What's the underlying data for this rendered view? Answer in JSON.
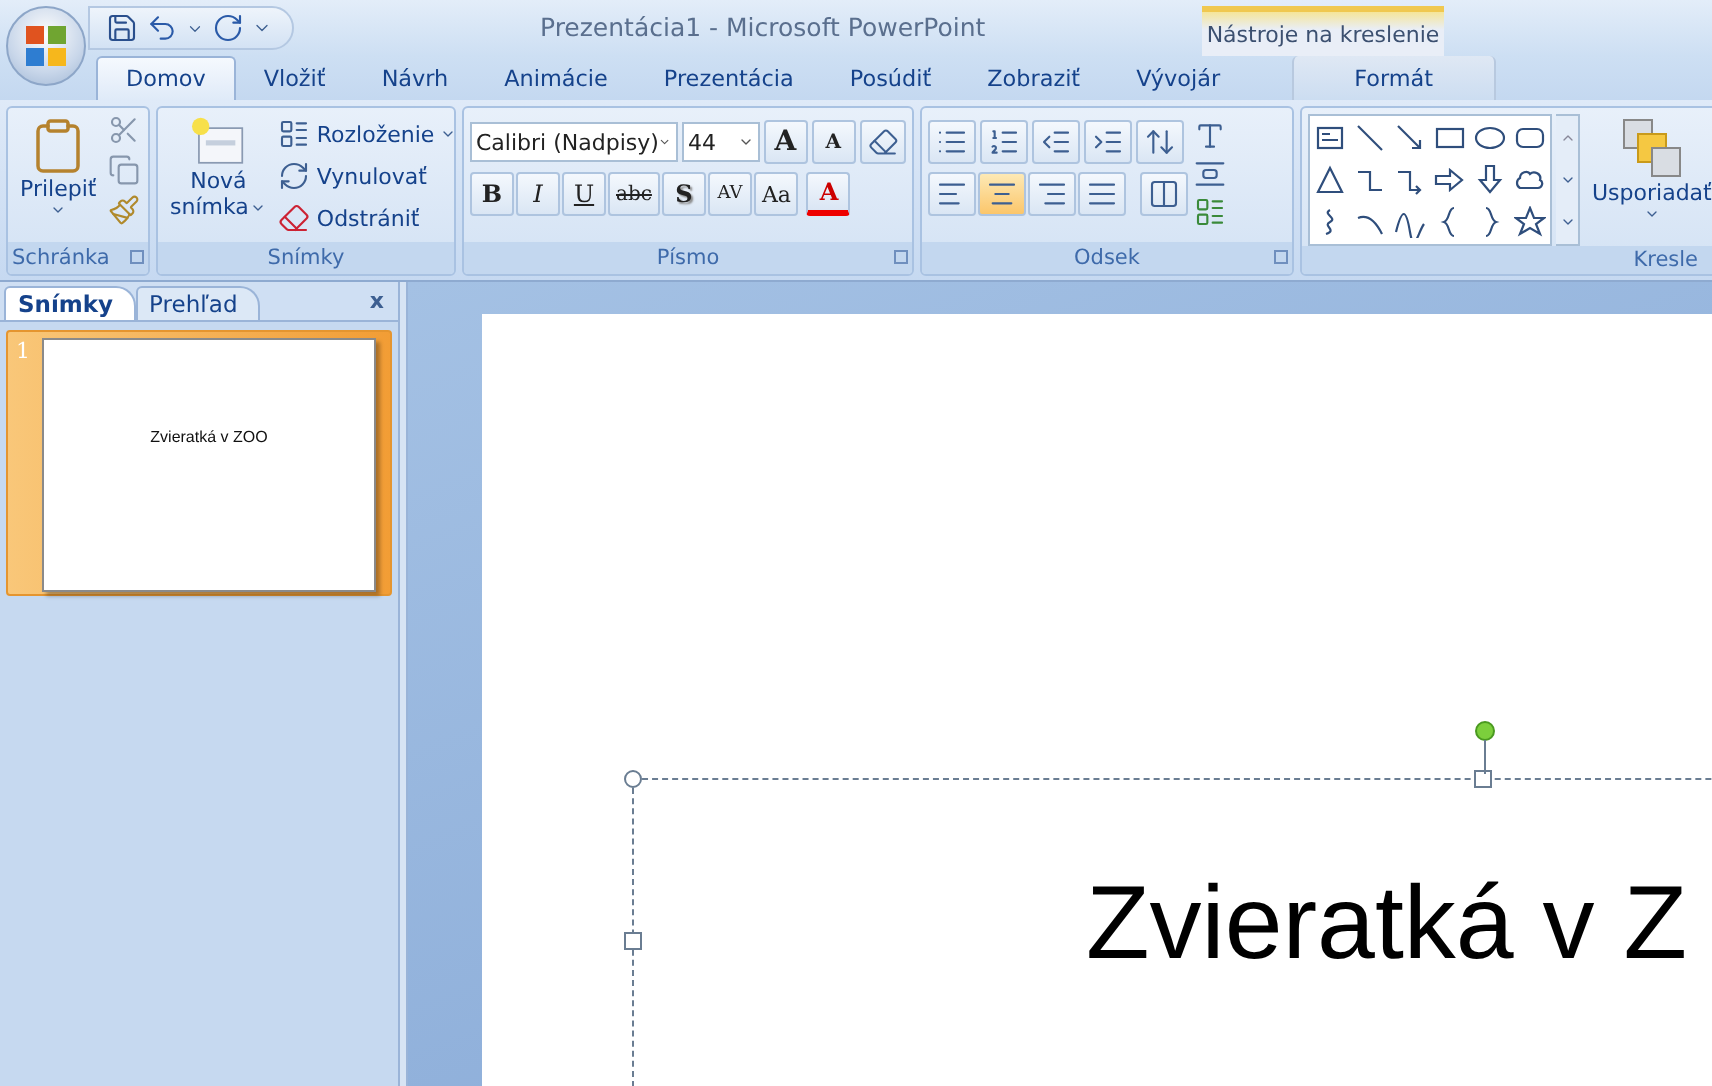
{
  "window": {
    "title": "Prezentácia1 - Microsoft PowerPoint"
  },
  "contextual_group": {
    "label": "Nástroje na kreslenie"
  },
  "tabs": [
    {
      "label": "Domov",
      "selected": true,
      "contextual": false
    },
    {
      "label": "Vložiť",
      "selected": false,
      "contextual": false
    },
    {
      "label": "Návrh",
      "selected": false,
      "contextual": false
    },
    {
      "label": "Animácie",
      "selected": false,
      "contextual": false
    },
    {
      "label": "Prezentácia",
      "selected": false,
      "contextual": false
    },
    {
      "label": "Posúdiť",
      "selected": false,
      "contextual": false
    },
    {
      "label": "Zobraziť",
      "selected": false,
      "contextual": false
    },
    {
      "label": "Vývojár",
      "selected": false,
      "contextual": false
    },
    {
      "label": "Formát",
      "selected": false,
      "contextual": true
    }
  ],
  "clipboard": {
    "label": "Schránka",
    "paste": "Prilepiť"
  },
  "slides_group": {
    "label": "Snímky",
    "new_slide": [
      "Nová",
      "snímka"
    ],
    "layout": "Rozloženie",
    "reset": "Vynulovať",
    "delete": "Odstrániť"
  },
  "font": {
    "label": "Písmo",
    "font_name": "Calibri (Nadpisy)",
    "font_size": "44",
    "grow": "A",
    "shrink": "A",
    "styles": [
      {
        "kind": "bold",
        "text": "B"
      },
      {
        "kind": "italic",
        "text": "I"
      },
      {
        "kind": "underline",
        "text": "U"
      },
      {
        "kind": "strike",
        "text": "abc"
      },
      {
        "kind": "shadow",
        "text": "S"
      },
      {
        "kind": "spacing",
        "text": "AV"
      },
      {
        "kind": "case",
        "text": "Aa"
      }
    ],
    "color_button": "A"
  },
  "paragraph": {
    "label": "Odsek",
    "alignments": [
      {
        "kind": "left",
        "selected": false
      },
      {
        "kind": "center",
        "selected": true
      },
      {
        "kind": "right",
        "selected": false
      },
      {
        "kind": "justify",
        "selected": false
      }
    ]
  },
  "drawing": {
    "label": "Kresle",
    "arrange": "Usporiadať"
  },
  "side_panel": {
    "tabs": [
      {
        "label": "Snímky",
        "selected": true
      },
      {
        "label": "Prehľad",
        "selected": false
      }
    ],
    "close": "x",
    "slides": [
      {
        "number": "1",
        "text": "Zvieratká v ZOO",
        "selected": true
      }
    ]
  },
  "slide": {
    "title": "Zvieratká v Z",
    "title_selected": true
  }
}
